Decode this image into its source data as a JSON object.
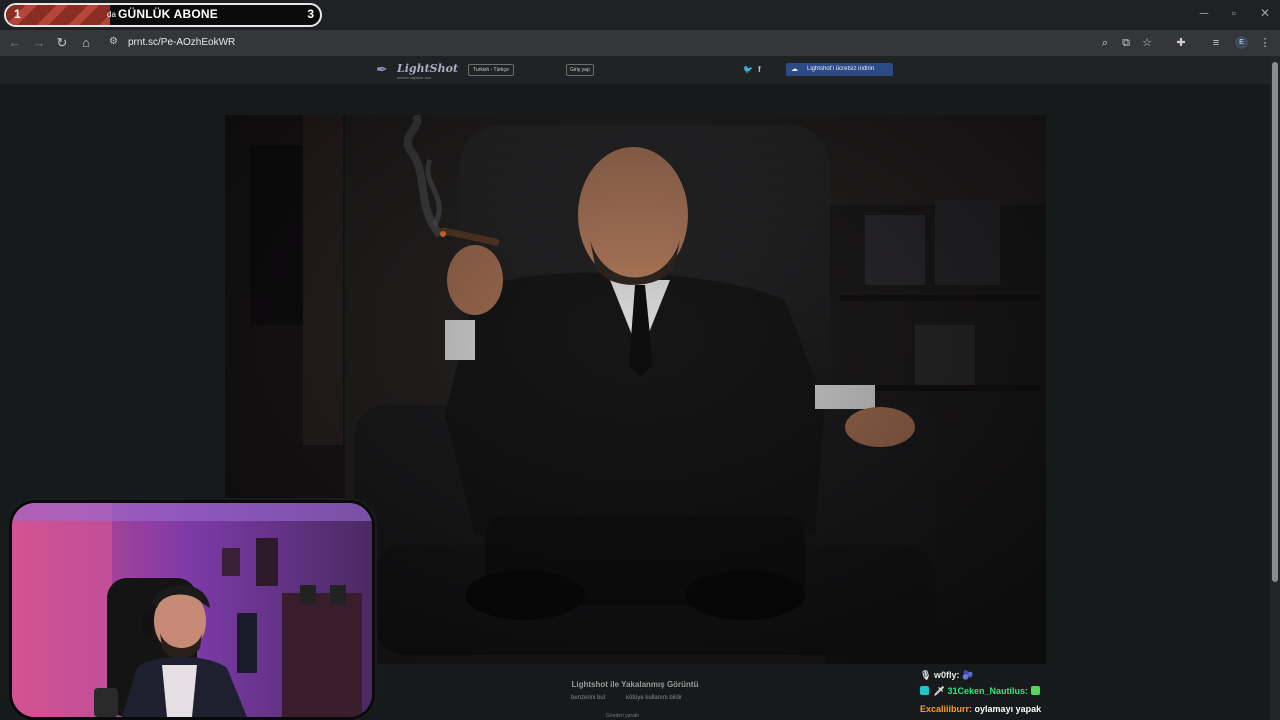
{
  "overlay": {
    "sub_goal_start": "1",
    "sub_goal_small": "da",
    "sub_goal_title": "GÜNLÜK ABONE",
    "sub_goal_end": "3",
    "sub_goal_progress": 0.33
  },
  "window": {
    "minimize": "─",
    "restore": "▫",
    "close": "✕"
  },
  "browser": {
    "url": "prnt.sc/Pe-AOzhEokWR",
    "icons": [
      "back-icon",
      "forward-icon",
      "reload-icon",
      "home-icon",
      "site-settings-icon",
      "zoom-icon",
      "install-icon",
      "bookmark-star-icon",
      "extensions-icon",
      "media-controls-icon",
      "profile-icon",
      "menu-icon"
    ],
    "profile_initial": "E"
  },
  "lightshot": {
    "logo": "LightShot",
    "tagline": "screen capture tool",
    "language": "Turkish - Türkçe",
    "login": "Giriş yap",
    "twitter": "t",
    "facebook": "f",
    "download": "Lightshot'ı ücretsiz indirin",
    "caption": "Lightshot ile Yakalanmış Görüntü",
    "find_similar": "benzerini bul",
    "report": "kötüye kullanım bildir",
    "share": "Gönderi yarattı"
  },
  "chat": [
    {
      "user": "w0fly:",
      "message": "",
      "color": "#e9e9e9"
    },
    {
      "user": "31Ceken_Nautilus:",
      "message": "",
      "color": "#2ee67e"
    },
    {
      "user": "Excaliiiburr:",
      "message": "oylamayı yapak",
      "color": "#ff9f1a"
    }
  ]
}
